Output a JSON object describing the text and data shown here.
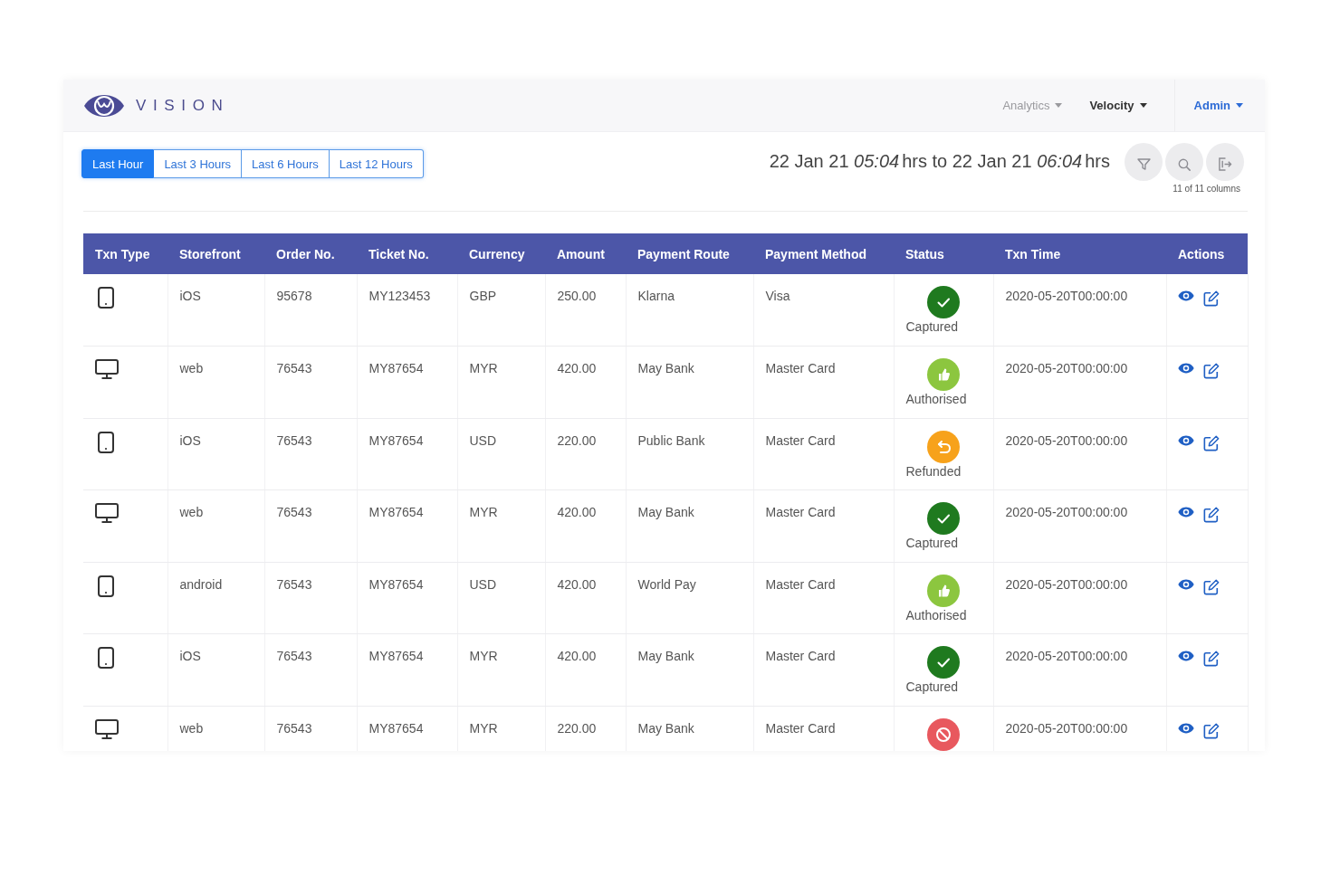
{
  "header": {
    "logo_text": "VISION",
    "nav": [
      {
        "label": "Analytics",
        "selected": false
      },
      {
        "label": "Velocity",
        "selected": true
      }
    ],
    "user_menu": {
      "label": "Admin"
    }
  },
  "toolbar": {
    "time_range_tabs": [
      {
        "label": "Last Hour",
        "selected": true
      },
      {
        "label": "Last 3 Hours",
        "selected": false
      },
      {
        "label": "Last 6 Hours",
        "selected": false
      },
      {
        "label": "Last 12 Hours",
        "selected": false
      }
    ],
    "date_range": {
      "start_date": "22 Jan 21",
      "start_time": "05:04",
      "start_unit": "hrs",
      "separator": "to",
      "end_date": "22 Jan 21",
      "end_time": "06:04",
      "end_unit": "hrs"
    },
    "column_count": "11 of 11 columns"
  },
  "table": {
    "columns": [
      "Txn Type",
      "Storefront",
      "Order No.",
      "Ticket No.",
      "Currency",
      "Amount",
      "Payment Route",
      "Payment Method",
      "Status",
      "Txn Time",
      "Actions"
    ],
    "rows": [
      {
        "txn_type": {
          "kind": "mobile"
        },
        "storefront": "iOS",
        "order_no": "95678",
        "ticket_no": "MY123453",
        "currency": "GBP",
        "amount": "250.00",
        "payment_route": "Klarna",
        "payment_method": "Visa",
        "status": {
          "kind": "captured",
          "label": "Captured",
          "color": "#1f7a1f"
        },
        "txn_time": "2020-05-20T00:00:00"
      },
      {
        "txn_type": {
          "kind": "desktop"
        },
        "storefront": "web",
        "order_no": "76543",
        "ticket_no": "MY87654",
        "currency": "MYR",
        "amount": "420.00",
        "payment_route": "May Bank",
        "payment_method": "Master Card",
        "status": {
          "kind": "authorised",
          "label": "Authorised",
          "color": "#8cc63f"
        },
        "txn_time": "2020-05-20T00:00:00"
      },
      {
        "txn_type": {
          "kind": "mobile"
        },
        "storefront": "iOS",
        "order_no": "76543",
        "ticket_no": "MY87654",
        "currency": "USD",
        "amount": "220.00",
        "payment_route": "Public Bank",
        "payment_method": "Master Card",
        "status": {
          "kind": "refunded",
          "label": "Refunded",
          "color": "#f7a21b"
        },
        "txn_time": "2020-05-20T00:00:00"
      },
      {
        "txn_type": {
          "kind": "desktop"
        },
        "storefront": "web",
        "order_no": "76543",
        "ticket_no": "MY87654",
        "currency": "MYR",
        "amount": "420.00",
        "payment_route": "May Bank",
        "payment_method": "Master Card",
        "status": {
          "kind": "captured",
          "label": "Captured",
          "color": "#1f7a1f"
        },
        "txn_time": "2020-05-20T00:00:00"
      },
      {
        "txn_type": {
          "kind": "mobile"
        },
        "storefront": "android",
        "order_no": "76543",
        "ticket_no": "MY87654",
        "currency": "USD",
        "amount": "420.00",
        "payment_route": "World Pay",
        "payment_method": "Master Card",
        "status": {
          "kind": "authorised",
          "label": "Authorised",
          "color": "#8cc63f"
        },
        "txn_time": "2020-05-20T00:00:00"
      },
      {
        "txn_type": {
          "kind": "mobile"
        },
        "storefront": "iOS",
        "order_no": "76543",
        "ticket_no": "MY87654",
        "currency": "MYR",
        "amount": "420.00",
        "payment_route": "May Bank",
        "payment_method": "Master Card",
        "status": {
          "kind": "captured",
          "label": "Captured",
          "color": "#1f7a1f"
        },
        "txn_time": "2020-05-20T00:00:00"
      },
      {
        "txn_type": {
          "kind": "desktop"
        },
        "storefront": "web",
        "order_no": "76543",
        "ticket_no": "MY87654",
        "currency": "MYR",
        "amount": "220.00",
        "payment_route": "May Bank",
        "payment_method": "Master Card",
        "status": {
          "kind": "declined",
          "color": "#e8585e"
        },
        "txn_time": "2020-05-20T00:00:00"
      }
    ]
  }
}
